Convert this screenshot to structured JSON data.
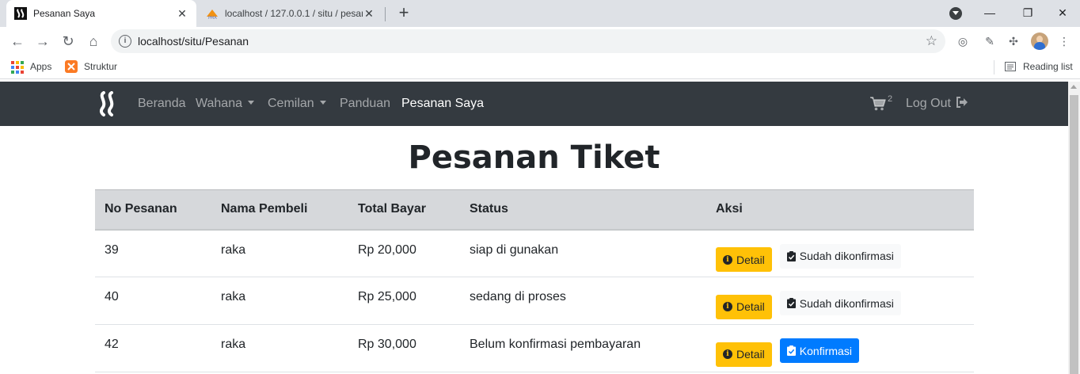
{
  "browser": {
    "tabs": [
      {
        "title": "Pesanan Saya",
        "active": true
      },
      {
        "title": "localhost / 127.0.0.1 / situ / pesanan",
        "active": false
      }
    ],
    "url": "localhost/situ/Pesanan",
    "bookmarks": [
      {
        "label": "Apps"
      },
      {
        "label": "Struktur"
      }
    ],
    "reading_list": "Reading list"
  },
  "navbar": {
    "links": [
      {
        "label": "Beranda"
      },
      {
        "label": "Wahana"
      },
      {
        "label": "Cemilan"
      },
      {
        "label": "Panduan"
      },
      {
        "label": "Pesanan Saya"
      }
    ],
    "cart_count": "2",
    "logout": "Log Out"
  },
  "page": {
    "title": "Pesanan Tiket",
    "table": {
      "headers": [
        "No Pesanan",
        "Nama Pembeli",
        "Total Bayar",
        "Status",
        "Aksi"
      ],
      "rows": [
        {
          "no": "39",
          "nama": "raka",
          "total": "Rp 20,000",
          "status": "siap di gunakan",
          "detail": "Detail",
          "action": "Sudah dikonfirmasi"
        },
        {
          "no": "40",
          "nama": "raka",
          "total": "Rp 25,000",
          "status": "sedang di proses",
          "detail": "Detail",
          "action": "Sudah dikonfirmasi"
        },
        {
          "no": "42",
          "nama": "raka",
          "total": "Rp 30,000",
          "status": "Belum konfirmasi pembayaran",
          "detail": "Detail",
          "action": "Konfirmasi"
        }
      ]
    }
  },
  "colors": {
    "navbar_bg": "#343a40",
    "warning": "#ffc107",
    "primary": "#007bff",
    "light": "#f8f9fa",
    "table_head": "#d6d8db"
  },
  "icons": [
    "site-logo-icon",
    "phpmyadmin-icon",
    "close-icon",
    "plus-icon",
    "back-icon",
    "forward-icon",
    "reload-icon",
    "home-icon",
    "info-icon",
    "star-icon",
    "puzzle-icon",
    "menu-icon",
    "cart-icon",
    "logout-icon",
    "clipboard-check-icon"
  ]
}
